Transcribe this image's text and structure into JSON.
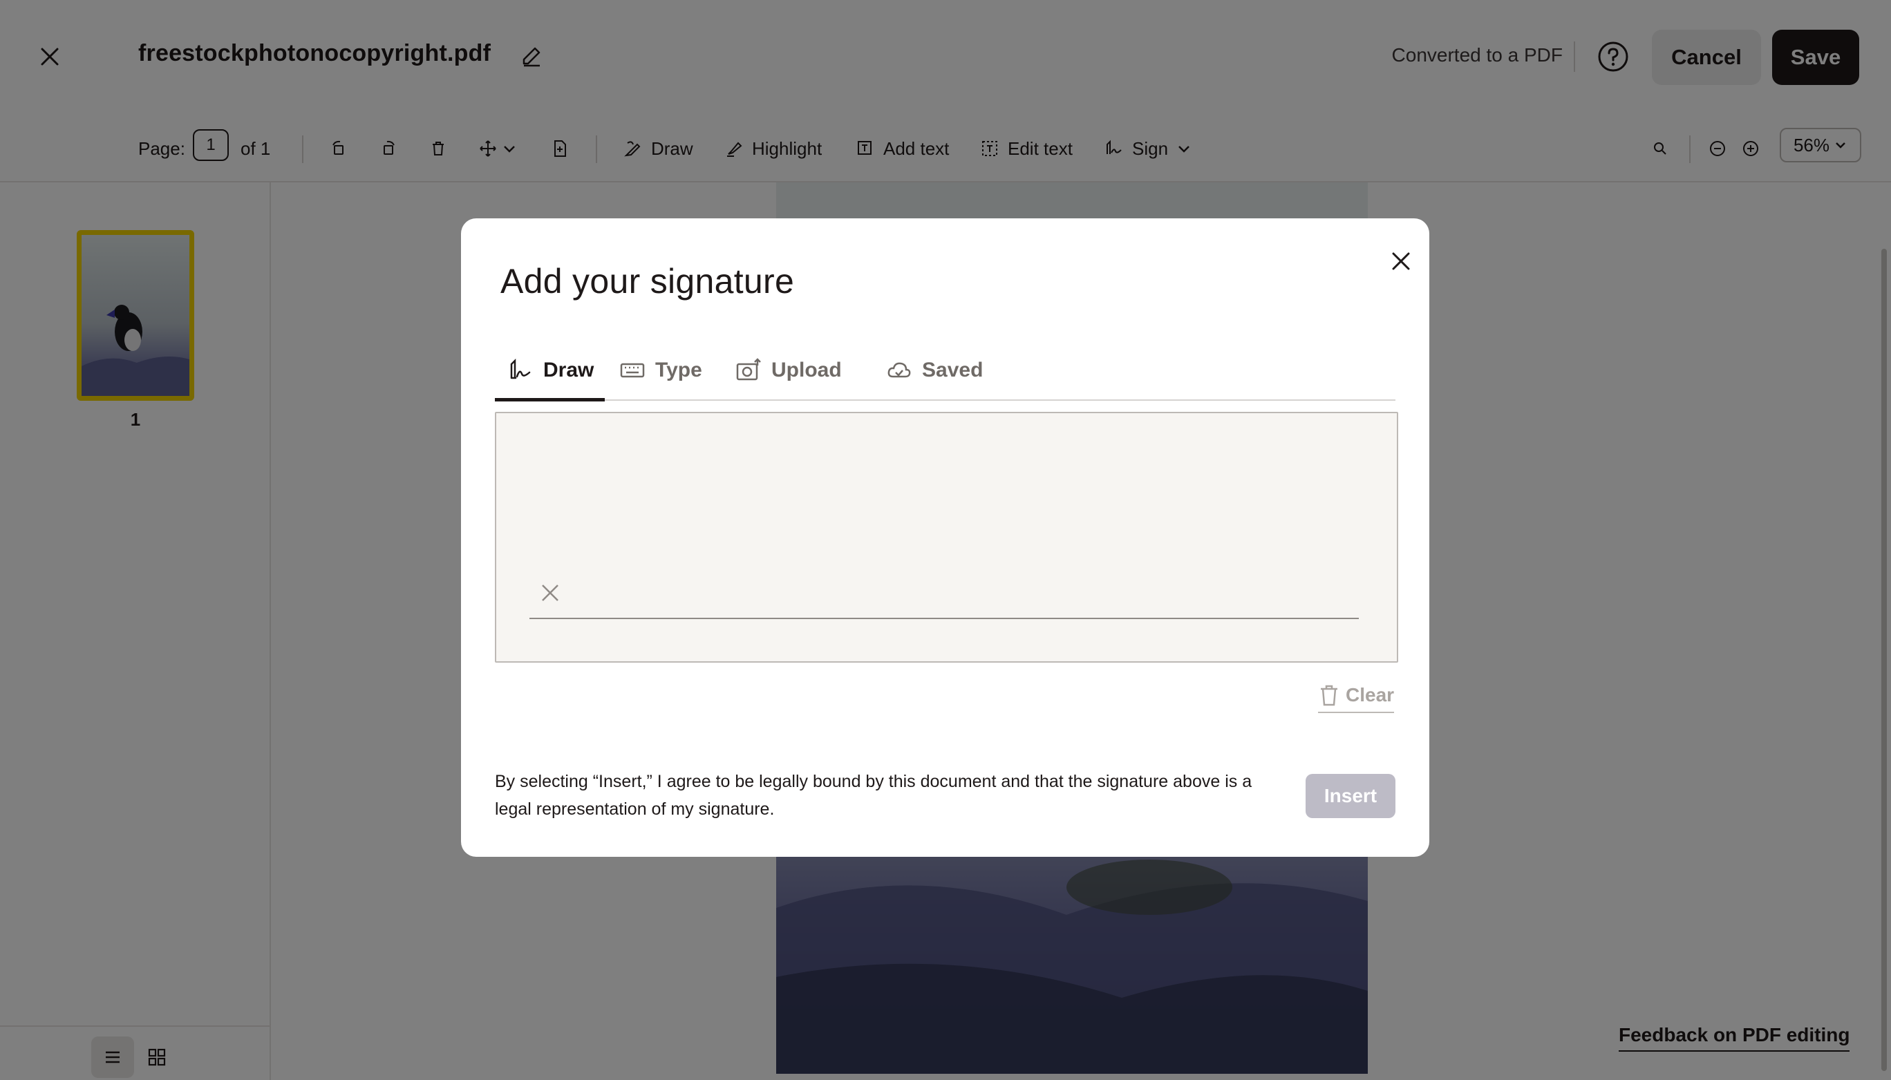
{
  "header": {
    "filename": "freestockphotonocopyright.pdf",
    "status": "Converted to a PDF",
    "cancel_label": "Cancel",
    "save_label": "Save"
  },
  "toolbar": {
    "page_label": "Page:",
    "page_value": "1",
    "page_of": "of 1",
    "draw_label": "Draw",
    "highlight_label": "Highlight",
    "add_text_label": "Add text",
    "edit_text_label": "Edit text",
    "sign_label": "Sign",
    "zoom_value": "56%"
  },
  "sidebar": {
    "thumbnails": [
      {
        "page_number": "1",
        "selected": true
      }
    ],
    "view_mode": "list"
  },
  "feedback_label": "Feedback on PDF editing",
  "modal": {
    "title": "Add your signature",
    "tabs": [
      {
        "label": "Draw",
        "icon": "pen-signature-icon",
        "active": true
      },
      {
        "label": "Type",
        "icon": "keyboard-icon",
        "active": false
      },
      {
        "label": "Upload",
        "icon": "camera-upload-icon",
        "active": false
      },
      {
        "label": "Saved",
        "icon": "cloud-icon",
        "active": false
      }
    ],
    "clear_label": "Clear",
    "legal_text": "By selecting “Insert,” I agree to be legally bound by this document and that the signature above is a legal representation of my signature.",
    "insert_label": "Insert"
  },
  "colors": {
    "accent_dark": "#1e1919",
    "thumbnail_selected": "#f2d200",
    "insert_disabled": "#bdbbc6"
  }
}
